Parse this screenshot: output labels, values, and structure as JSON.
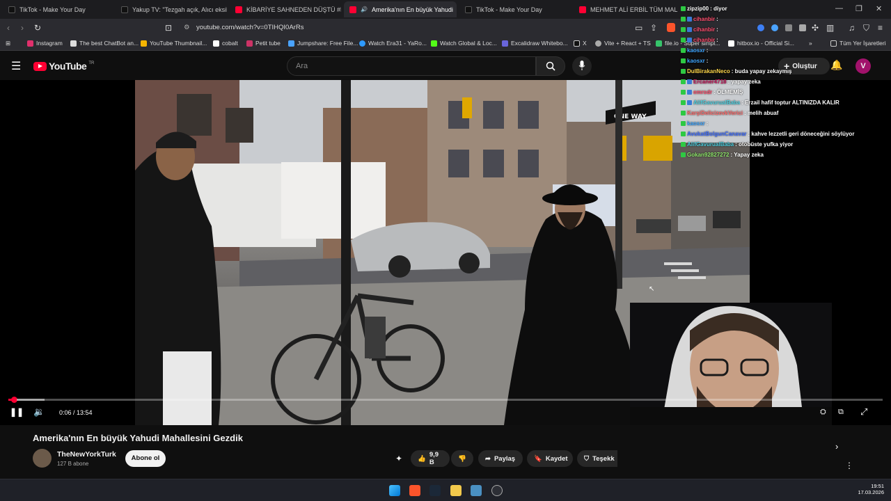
{
  "tabs": [
    {
      "label": "TikTok - Make Your Day",
      "color": "#111111"
    },
    {
      "label": "Yakup TV: \"Tezgah açık, Alıcı eksik!\" #",
      "color": "#111111"
    },
    {
      "label": "KİBARİYE SAHNEDEN DÜŞTÜ #KİBAR",
      "color": "#ff0033"
    },
    {
      "label": "Amerika'nın En büyük Yahudi",
      "color": "#ff0033"
    },
    {
      "label": "TikTok - Make Your Day",
      "color": "#111111"
    },
    {
      "label": "MEHMET ALİ ERBİL TÜM MALLIKLAR",
      "color": "#ff0033"
    }
  ],
  "address": {
    "url": "youtube.com/watch?v=0TIHQI0ArRs"
  },
  "bookmarks": [
    {
      "label": "Instagram",
      "color": "#e1306c"
    },
    {
      "label": "The best ChatBot an...",
      "color": "#dddddd"
    },
    {
      "label": "YouTube Thumbnail...",
      "color": "#f4b400"
    },
    {
      "label": "cobalt",
      "color": "#ffffff"
    },
    {
      "label": "Petit tube",
      "color": "#cc3366"
    },
    {
      "label": "Jumpshare: Free File...",
      "color": "#4aa3ff"
    },
    {
      "label": "Watch Era31 - YaRo...",
      "color": "#2e9afe"
    },
    {
      "label": "Watch Global & Loc...",
      "color": "#53fc18"
    },
    {
      "label": "Excalidraw Whitebo...",
      "color": "#6965db"
    },
    {
      "label": "X",
      "color": "#ffffff"
    },
    {
      "label": "Vite + React + TS",
      "color": "#ffffff"
    },
    {
      "label": "file.io - Super simpl...",
      "color": "#36c46b"
    },
    {
      "label": "hitbox.io - Official Si...",
      "color": "#ffffff"
    },
    {
      "label": "Tüm Yer İşaretleri",
      "color": "#dddddd"
    }
  ],
  "youtube": {
    "logo": "YouTube",
    "region": "TR",
    "search_placeholder": "Ara",
    "create_label": "Oluştur",
    "avatar_letter": "V"
  },
  "player": {
    "time": "0:06 / 13:54",
    "progress_fraction": 0.007
  },
  "video": {
    "title": "Amerika'nın En büyük Yahudi Mahallesini Gezdik",
    "channel": "TheNewYorkTurk",
    "subs": "127 B abone",
    "subscribe": "Abone ol",
    "likes": "9,9 B",
    "share": "Paylaş",
    "save": "Kaydet",
    "thanks": "Teşekk"
  },
  "street_sign": "ONE WAY",
  "chat": [
    {
      "user": "zipzip00",
      "msg": ": diyor",
      "ucolor": "#ffffff"
    },
    {
      "user": "cihanbir",
      "msg": ":",
      "ucolor": "#ff4d6d"
    },
    {
      "user": "cihanbir",
      "msg": ":",
      "ucolor": "#ff4d6d"
    },
    {
      "user": "cihanbir",
      "msg": ":",
      "ucolor": "#ff4d6d"
    },
    {
      "user": "kaosxr",
      "msg": ":",
      "ucolor": "#3da5ff"
    },
    {
      "user": "kaosxr",
      "msg": ":",
      "ucolor": "#3da5ff"
    },
    {
      "user": "DulBirakanNeco",
      "msg": ": buda yapay zekaymış",
      "ucolor": "#ffd84a"
    },
    {
      "user": "Ercaner4718",
      "msg": ": yapay zeka",
      "ucolor": "#c2185b"
    },
    {
      "user": "emrsdr",
      "msg": ": ÖLMEMİŞ",
      "ucolor": "#ff4d6d"
    },
    {
      "user": "AlifGavurualBaba",
      "msg": ": Erzail hafif toptur ALTINIZDA KALIR",
      "ucolor": "#4dd0e1"
    },
    {
      "user": "KarşiDelicizevkVerici",
      "msg": ": melih abuaf",
      "ucolor": "#ff6b6b"
    },
    {
      "user": "kaosxr",
      "msg": ":",
      "ucolor": "#3da5ff"
    },
    {
      "user": "AvukatBolgunCanavar",
      "msg": ": kahve lezzetli geri döneceğini söylüyor",
      "ucolor": "#3d6cff"
    },
    {
      "user": "AlifGavurualBaba",
      "msg": ": otobüste yufka yiyor",
      "ucolor": "#4dd0e1"
    },
    {
      "user": "Gokan92827272",
      "msg": ": Yapay zeka",
      "ucolor": "#8ee66b"
    }
  ],
  "clock": {
    "time": "19:51",
    "date": "17.03.2026"
  }
}
